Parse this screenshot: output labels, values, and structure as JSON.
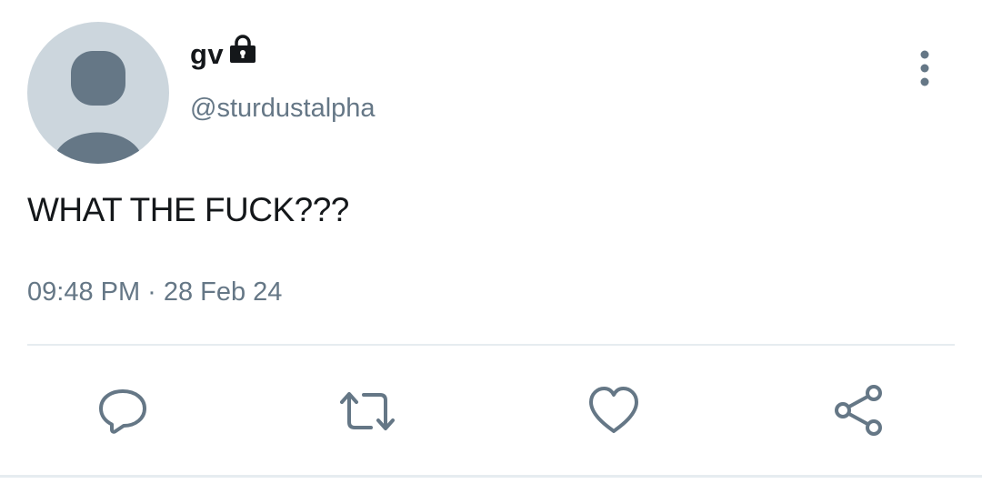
{
  "tweet": {
    "display_name": "gv",
    "handle": "@sturdustalpha",
    "text": "WHAT THE FUCK???",
    "time": "09:48 PM",
    "separator": "·",
    "date": "28 Feb 24",
    "protected": true
  },
  "icons": {
    "avatar": "default-avatar-icon",
    "lock": "lock-icon",
    "more": "more-vertical-icon",
    "reply": "reply-icon",
    "retweet": "retweet-icon",
    "like": "heart-icon",
    "share": "share-icon"
  },
  "colors": {
    "text_primary": "#14171a",
    "text_secondary": "#657786",
    "avatar_bg": "#ccd6dd",
    "avatar_fg": "#657786",
    "divider": "#e6ecf0"
  }
}
